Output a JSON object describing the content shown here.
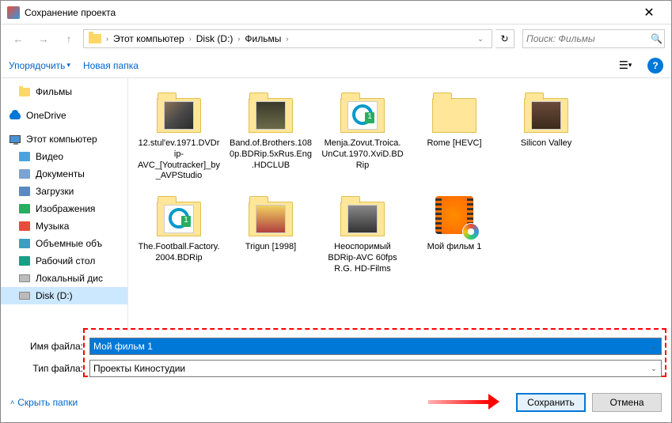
{
  "title": "Сохранение проекта",
  "breadcrumb": {
    "root": "Этот компьютер",
    "disk": "Disk (D:)",
    "folder": "Фильмы"
  },
  "search": {
    "placeholder": "Поиск: Фильмы"
  },
  "toolbar": {
    "organize": "Упорядочить",
    "newfolder": "Новая папка"
  },
  "sidebar": {
    "films": "Фильмы",
    "onedrive": "OneDrive",
    "pc": "Этот компьютер",
    "video": "Видео",
    "docs": "Документы",
    "downloads": "Загрузки",
    "pictures": "Изображения",
    "music": "Музыка",
    "volumes": "Объемные объ",
    "desktop": "Рабочий стол",
    "localdisk": "Локальный дис",
    "diskd": "Disk (D:)"
  },
  "items": [
    {
      "label": "12.stul'ev.1971.DVDrip-AVC_[Youtracker]_by_AVPStudio",
      "type": "folder-img",
      "variant": "stul"
    },
    {
      "label": "Band.of.Brothers.1080p.BDRip.5xRus.Eng.HDCLUB",
      "type": "folder-img",
      "variant": "bob"
    },
    {
      "label": "Menja.Zovut.Troica.UnCut.1970.XviD.BDRip",
      "type": "folder-disc"
    },
    {
      "label": "Rome [HEVC]",
      "type": "folder-plain"
    },
    {
      "label": "Silicon Valley",
      "type": "folder-img",
      "variant": "sv"
    },
    {
      "label": "The.Football.Factory.2004.BDRip",
      "type": "folder-disc"
    },
    {
      "label": "Trigun [1998]",
      "type": "folder-img",
      "variant": "trig"
    },
    {
      "label": "Неоспоримый BDRip-AVC 60fps R.G. HD-Films",
      "type": "folder-img",
      "variant": "neos"
    },
    {
      "label": "Мой фильм 1",
      "type": "wmm"
    }
  ],
  "fields": {
    "filename_label": "Имя файла:",
    "filename_value": "Мой фильм 1",
    "filetype_label": "Тип файла:",
    "filetype_value": "Проекты Киностудии"
  },
  "footer": {
    "hide": "Скрыть папки",
    "save": "Сохранить",
    "cancel": "Отмена"
  }
}
